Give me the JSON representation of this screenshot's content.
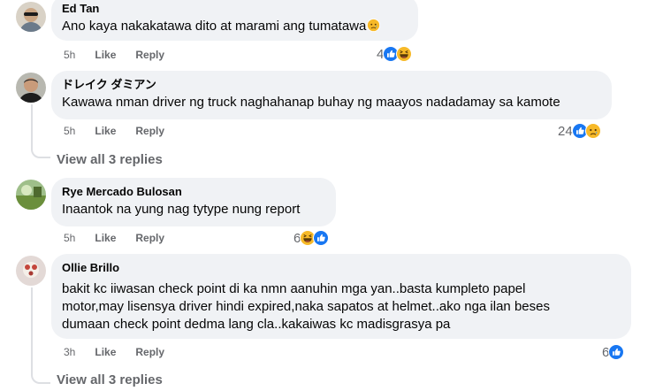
{
  "comments": [
    {
      "author": "Ed Tan",
      "text": "Ano kaya nakakatawa dito at marami ang tumatawa",
      "trailing_emoji": "sad-face",
      "time": "5h",
      "like_label": "Like",
      "reply_label": "Reply",
      "reaction_count": "4",
      "reactions": [
        "like",
        "haha"
      ]
    },
    {
      "author": "ドレイク ダミアン",
      "text": "Kawawa nman driver ng truck naghahanap buhay ng maayos nadadamay sa kamote",
      "time": "5h",
      "like_label": "Like",
      "reply_label": "Reply",
      "reaction_count": "24",
      "reactions": [
        "like",
        "sad"
      ],
      "view_replies": "View all 3 replies"
    },
    {
      "author": "Rye Mercado Bulosan",
      "text": "Inaantok na yung nag tytype nung report",
      "time": "5h",
      "like_label": "Like",
      "reply_label": "Reply",
      "reaction_count": "6",
      "reactions": [
        "haha",
        "like"
      ]
    },
    {
      "author": "Ollie Brillo",
      "text_lines": [
        "bakit kc iiwasan check point di ka nmn aanuhin mga yan..basta kumpleto papel",
        "motor,may lisensya driver hindi expired,naka sapatos at helmet..ako nga ilan beses",
        "dumaan check point dedma lang cla..kakaiwas kc madisgrasya pa"
      ],
      "time": "3h",
      "like_label": "Like",
      "reply_label": "Reply",
      "reaction_count": "6",
      "reactions": [
        "like"
      ],
      "view_replies": "View all 3 replies"
    }
  ],
  "colors": {
    "bubble": "#f0f2f5",
    "meta_text": "#65676b",
    "like_blue": "#1877f2",
    "emoji_yellow": "#f7b928"
  }
}
